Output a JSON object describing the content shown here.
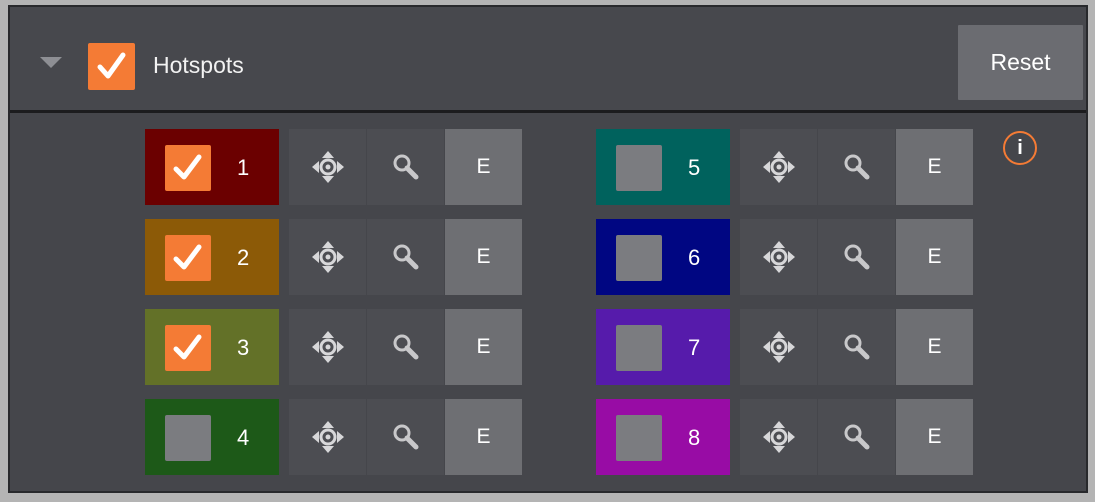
{
  "header": {
    "title": "Hotspots",
    "reset_label": "Reset",
    "enabled": true
  },
  "info_glyph": "i",
  "hotspots": [
    {
      "number": "1",
      "checked": true,
      "color": "#6b0000"
    },
    {
      "number": "2",
      "checked": true,
      "color": "#8c5a07"
    },
    {
      "number": "3",
      "checked": true,
      "color": "#637128"
    },
    {
      "number": "4",
      "checked": false,
      "color": "#1d5918"
    },
    {
      "number": "5",
      "checked": false,
      "color": "#00625d"
    },
    {
      "number": "6",
      "checked": false,
      "color": "#000682"
    },
    {
      "number": "7",
      "checked": false,
      "color": "#561bab"
    },
    {
      "number": "8",
      "checked": false,
      "color": "#980ca5"
    }
  ],
  "edit_label": "E",
  "colors": {
    "accent": "#f47b35",
    "panel": "#45464b",
    "button": "#6b6c71"
  },
  "icons": {
    "move": "move-arrows-icon",
    "zoom": "magnifier-icon",
    "info": "info-icon",
    "collapse": "triangle-down-icon"
  }
}
